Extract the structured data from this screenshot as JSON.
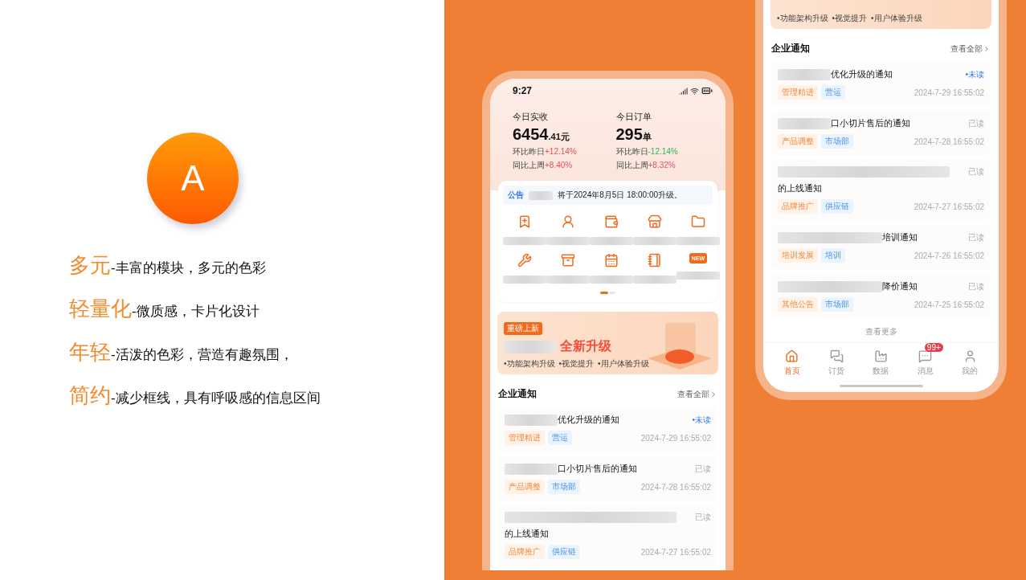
{
  "slide": {
    "badge": "A",
    "points": [
      {
        "term": "多元",
        "desc": "-丰富的模块，多元的色彩"
      },
      {
        "term": "轻量化",
        "desc": "-微质感，卡片化设计"
      },
      {
        "term": "年轻",
        "desc": "-活泼的色彩，营造有趣氛围，"
      },
      {
        "term": "简约",
        "desc": "-减少框线，具有呼吸感的信息区间"
      }
    ]
  },
  "phone_home": {
    "status_bar": {
      "time": "9:27"
    },
    "stats": [
      {
        "label": "今日实收",
        "value": "6454",
        "unit": ".41元",
        "comparisons": [
          {
            "label": "环比昨日",
            "value": "+12.14%",
            "color": "#ef4d5c"
          },
          {
            "label": "同比上周",
            "value": "+8.40%",
            "color": "#ef4d5c"
          }
        ]
      },
      {
        "label": "今日订单",
        "value": "295",
        "unit": "单",
        "comparisons": [
          {
            "label": "环比昨日",
            "value": "-12.14%",
            "color": "#2db562"
          },
          {
            "label": "同比上周",
            "value": "+8.32%",
            "color": "#ef4d5c"
          }
        ]
      }
    ],
    "announcement": {
      "tag": "公告",
      "text": "将于2024年8月5日 18:00:00升级。"
    },
    "shortcuts": [
      {
        "kind": "icon"
      },
      {
        "kind": "icon"
      },
      {
        "kind": "icon"
      },
      {
        "kind": "icon"
      },
      {
        "kind": "icon"
      },
      {
        "kind": "icon"
      },
      {
        "kind": "icon"
      },
      {
        "kind": "icon"
      },
      {
        "kind": "icon"
      },
      {
        "kind": "text_icon",
        "icon_text": "NEW"
      }
    ],
    "pager": [
      {
        "selected": true
      },
      {
        "selected": false
      }
    ],
    "banner": {
      "badge": "重磅上新",
      "title": "全新升级",
      "bullets": [
        "•功能架构升级",
        "•视觉提升",
        "•用户体验升级"
      ]
    },
    "notices": {
      "title": "企业通知",
      "more": "查看全部",
      "items": [
        {
          "kind": "short",
          "title": "优化升级的通知",
          "read": false,
          "status": "•未读",
          "tags": [
            {
              "label": "管理精进",
              "kind": "category"
            },
            {
              "label": "营运",
              "kind": "department"
            }
          ],
          "time": "2024-7-29 16:55:02"
        },
        {
          "kind": "short",
          "title": "口小切片售后的通知",
          "read": true,
          "status": "已读",
          "tags": [
            {
              "label": "产品调整",
              "kind": "category"
            },
            {
              "label": "市场部",
              "kind": "department"
            }
          ],
          "time": "2024-7-28 16:55:02"
        },
        {
          "kind": "wrapped",
          "title": "的上线通知",
          "read": true,
          "status": "已读",
          "tags": [
            {
              "label": "品牌推广",
              "kind": "category"
            },
            {
              "label": "供应链",
              "kind": "department"
            }
          ],
          "time": "2024-7-27 16:55:02"
        }
      ]
    }
  },
  "phone_messages": {
    "banner": {
      "bullets": [
        "•功能架构升级",
        "•视觉提升",
        "•用户体验升级"
      ]
    },
    "notices": {
      "title": "企业通知",
      "more": "查看全部",
      "items": [
        {
          "kind": "short",
          "title": "优化升级的通知",
          "read": false,
          "status": "•未读",
          "tags": [
            {
              "label": "管理精进",
              "kind": "category"
            },
            {
              "label": "营运",
              "kind": "department"
            }
          ],
          "time": "2024-7-29 16:55:02"
        },
        {
          "kind": "short",
          "title": "口小切片售后的通知",
          "read": true,
          "status": "已读",
          "tags": [
            {
              "label": "产品调整",
              "kind": "category"
            },
            {
              "label": "市场部",
              "kind": "department"
            }
          ],
          "time": "2024-7-28 16:55:02"
        },
        {
          "kind": "wrapped",
          "title": "的上线通知",
          "read": true,
          "status": "已读",
          "tags": [
            {
              "label": "品牌推广",
              "kind": "category"
            },
            {
              "label": "供应链",
              "kind": "department"
            }
          ],
          "time": "2024-7-27 16:55:02"
        },
        {
          "kind": "long",
          "title": "培训通知",
          "read": true,
          "status": "已读",
          "tags": [
            {
              "label": "培训发展",
              "kind": "category"
            },
            {
              "label": "培训",
              "kind": "department"
            }
          ],
          "time": "2024-7-26 16:55:02"
        },
        {
          "kind": "long",
          "title": "降价通知",
          "read": true,
          "status": "已读",
          "tags": [
            {
              "label": "其他公告",
              "kind": "category"
            },
            {
              "label": "市场部",
              "kind": "department"
            }
          ],
          "time": "2024-7-25 16:55:02"
        }
      ]
    },
    "load_more": "查看更多",
    "tab_bar": [
      {
        "label": "首页",
        "selected": true
      },
      {
        "label": "订货",
        "selected": false
      },
      {
        "label": "数据",
        "selected": false
      },
      {
        "label": "消息",
        "selected": false,
        "badge": "99+"
      },
      {
        "label": "我的",
        "selected": false
      }
    ]
  }
}
